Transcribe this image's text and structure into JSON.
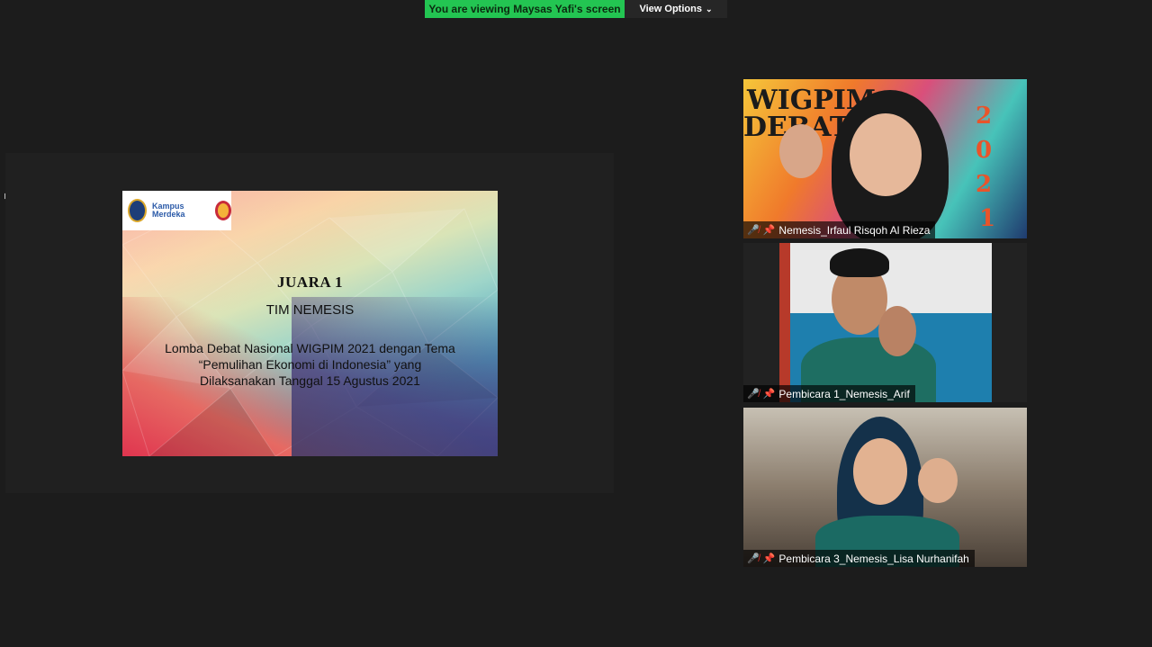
{
  "top_bar": {
    "share_banner": "You are viewing Maysas Yafi's screen",
    "view_options": "View Options"
  },
  "slide": {
    "title": "JUARA 1",
    "team": "TIM NEMESIS",
    "lines": [
      "Lomba Debat Nasional WIGPIM 2021 dengan Tema",
      "“Pemulihan Ekonomi di Indonesia” yang",
      "Dilaksanakan Tanggal 15 Agustus 2021"
    ],
    "logo_text": "Kampus Merdeka"
  },
  "participants": [
    {
      "name": "Nemesis_Irfaul Risqoh Al Rieza"
    },
    {
      "name": "Pembicara 1_Nemesis_Arif"
    },
    {
      "name": "Pembicara 3_Nemesis_Lisa Nurhanifah"
    }
  ],
  "tile1_background_text": {
    "left": "WIGPIM",
    "left2": "DEBAT",
    "year": [
      "2",
      "0",
      "2",
      "1"
    ]
  },
  "colors": {
    "share_green": "#23c552",
    "mic_muted": "#e0312b"
  }
}
